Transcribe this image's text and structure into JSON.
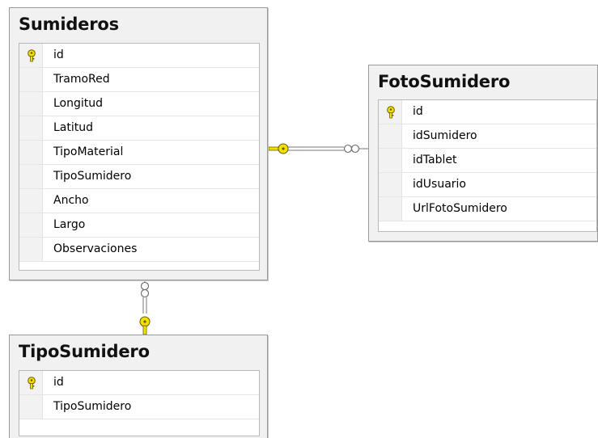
{
  "tables": {
    "sumideros": {
      "title": "Sumideros",
      "columns": [
        "id",
        "TramoRed",
        "Longitud",
        "Latitud",
        "TipoMaterial",
        "TipoSumidero",
        "Ancho",
        "Largo",
        "Observaciones"
      ]
    },
    "fotosumidero": {
      "title": "FotoSumidero",
      "columns": [
        "id",
        "idSumidero",
        "idTablet",
        "idUsuario",
        "UrlFotoSumidero"
      ]
    },
    "tiposumidero": {
      "title": "TipoSumidero",
      "columns": [
        "id",
        "TipoSumidero"
      ]
    }
  },
  "colors": {
    "key": "#f5e100",
    "key_outline": "#6b5a00",
    "line": "#777777"
  },
  "icons": {
    "primary_key": "key-icon",
    "one_end": "key-icon",
    "many_end": "infinity-icon"
  }
}
